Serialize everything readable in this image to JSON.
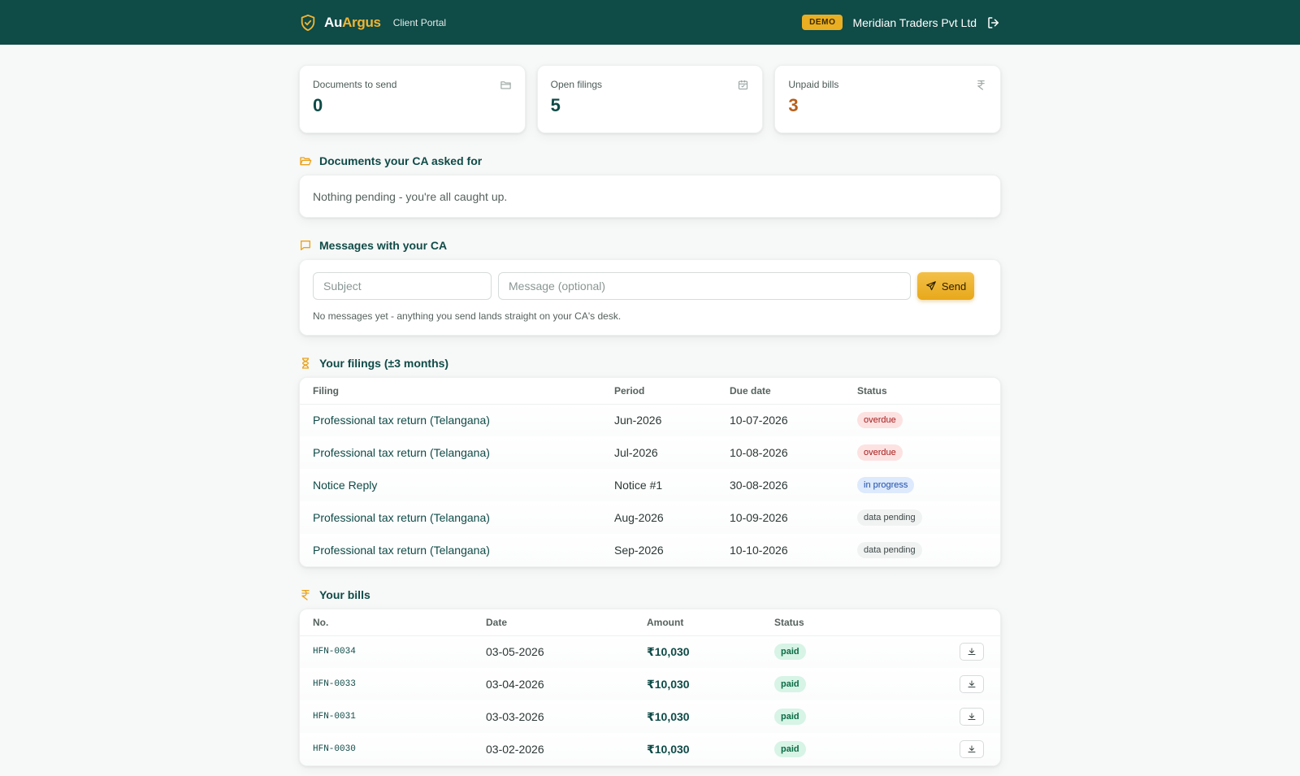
{
  "header": {
    "brand_prefix": "Au",
    "brand_suffix": "Argus",
    "portal_label": "Client Portal",
    "demo_badge": "DEMO",
    "company_name": "Meridian Traders Pvt Ltd",
    "colors": {
      "bar": "#0f4b47",
      "accent": "#f2b531"
    }
  },
  "stats": [
    {
      "label": "Documents to send",
      "value": "0",
      "icon": "folder-icon"
    },
    {
      "label": "Open filings",
      "value": "5",
      "icon": "calendar-icon"
    },
    {
      "label": "Unpaid bills",
      "value": "3",
      "icon": "rupee-icon"
    }
  ],
  "documents": {
    "title": "Documents your CA asked for",
    "empty_text": "Nothing pending - you're all caught up."
  },
  "messages": {
    "title": "Messages with your CA",
    "subject_placeholder": "Subject",
    "message_placeholder": "Message (optional)",
    "send_label": "Send",
    "note": "No messages yet - anything you send lands straight on your CA's desk."
  },
  "filings": {
    "title": "Your filings (±3 months)",
    "columns": [
      "Filing",
      "Period",
      "Due date",
      "Status"
    ],
    "rows": [
      {
        "filing": "Professional tax return (Telangana)",
        "period": "Jun-2026",
        "due": "10-07-2026",
        "status": "overdue"
      },
      {
        "filing": "Professional tax return (Telangana)",
        "period": "Jul-2026",
        "due": "10-08-2026",
        "status": "overdue"
      },
      {
        "filing": "Notice Reply",
        "period": "Notice #1",
        "due": "30-08-2026",
        "status": "in progress"
      },
      {
        "filing": "Professional tax return (Telangana)",
        "period": "Aug-2026",
        "due": "10-09-2026",
        "status": "data pending"
      },
      {
        "filing": "Professional tax return (Telangana)",
        "period": "Sep-2026",
        "due": "10-10-2026",
        "status": "data pending"
      }
    ]
  },
  "bills": {
    "title": "Your bills",
    "columns": [
      "No.",
      "Date",
      "Amount",
      "Status"
    ],
    "rows": [
      {
        "no": "HFN-0034",
        "date": "03-05-2026",
        "amount": "₹10,030",
        "status": "paid"
      },
      {
        "no": "HFN-0033",
        "date": "03-04-2026",
        "amount": "₹10,030",
        "status": "paid"
      },
      {
        "no": "HFN-0031",
        "date": "03-03-2026",
        "amount": "₹10,030",
        "status": "paid"
      },
      {
        "no": "HFN-0030",
        "date": "03-02-2026",
        "amount": "₹10,030",
        "status": "paid"
      }
    ]
  }
}
